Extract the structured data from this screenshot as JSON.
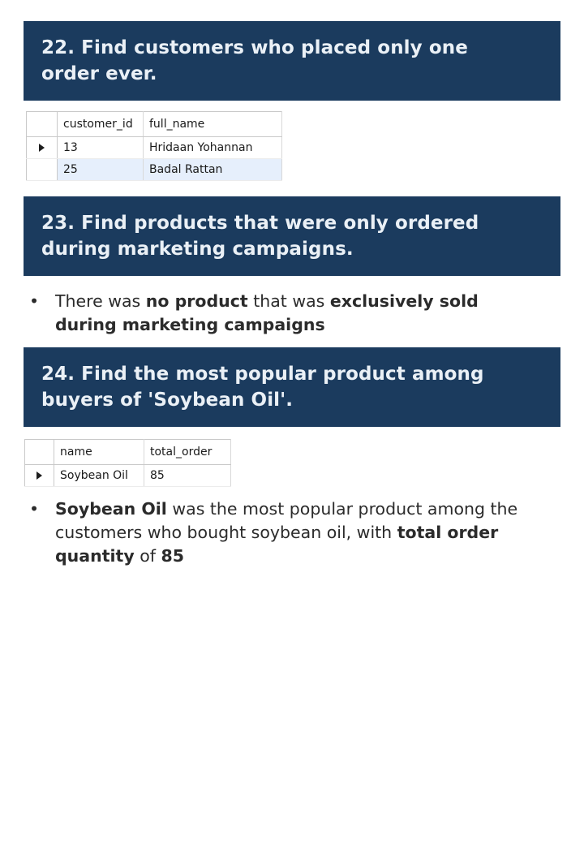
{
  "section22": {
    "title": "22. Find customers who placed only one order ever.",
    "table": {
      "columns": [
        "customer_id",
        "full_name"
      ],
      "rows": [
        {
          "customer_id": "13",
          "full_name": "Hridaan Yohannan"
        },
        {
          "customer_id": "25",
          "full_name": "Badal Rattan"
        }
      ]
    }
  },
  "section23": {
    "title": "23. Find products that were only ordered during marketing campaigns.",
    "bullet": {
      "marker": "•",
      "t1": "There was ",
      "b1": "no product",
      "t2": " that was ",
      "b2": "exclusively sold during marketing campaigns"
    }
  },
  "section24": {
    "title": "24. Find the most popular product among buyers of 'Soybean Oil'.",
    "table": {
      "columns": [
        "name",
        "total_order"
      ],
      "rows": [
        {
          "name": "Soybean Oil",
          "total_order": "85"
        }
      ]
    },
    "bullet": {
      "marker": "•",
      "b1": "Soybean Oil",
      "t1": " was the most popular product among the customers who bought soybean oil, with ",
      "b2": "total order quantity",
      "t2": " of ",
      "b3": "85"
    }
  },
  "colors": {
    "banner_bg": "#1b3b5e",
    "banner_text": "#eaf0f6",
    "selected_row": "#e6effc"
  }
}
